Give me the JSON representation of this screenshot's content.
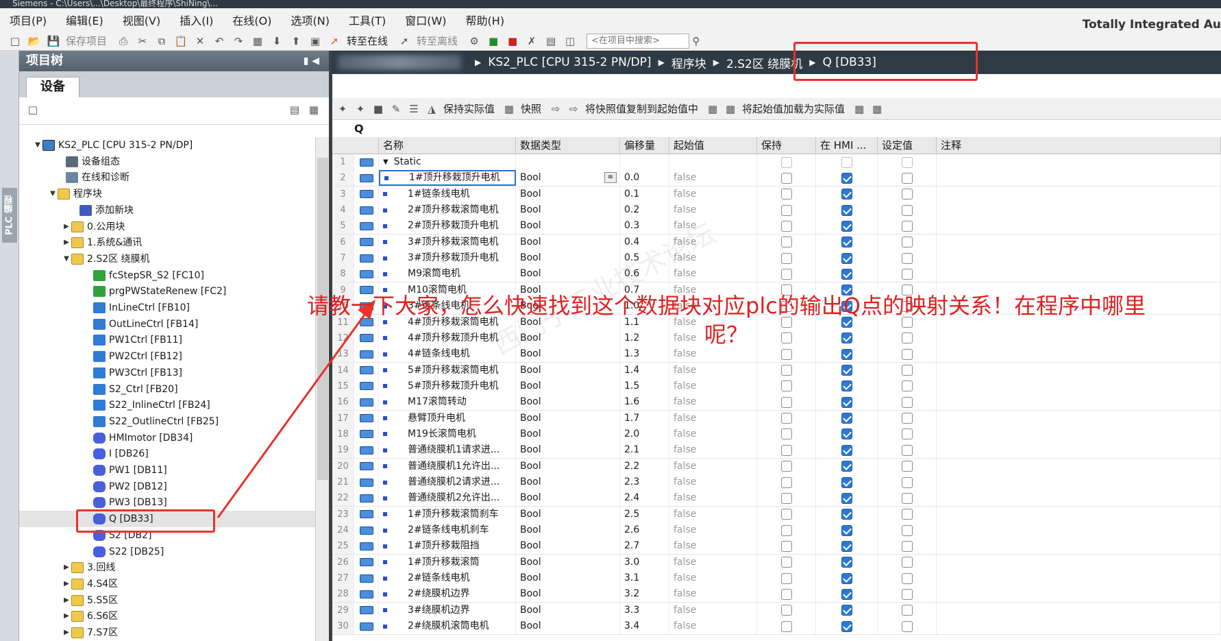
{
  "window": {
    "title": "Siemens - C:\\Users\\...\\Desktop\\最终程序\\ShiNing\\...",
    "brand": "Totally Integrated Au"
  },
  "menu": [
    "项目(P)",
    "编辑(E)",
    "视图(V)",
    "插入(I)",
    "在线(O)",
    "选项(N)",
    "工具(T)",
    "窗口(W)",
    "帮助(H)"
  ],
  "toolbar": {
    "save_project": "保存项目",
    "go_online": "转至在线",
    "go_offline": "转至离线",
    "search_placeholder": "<在项目中搜索>"
  },
  "sidetab": {
    "label": "PLC 编程"
  },
  "project_tree": {
    "header": "项目树",
    "devices_tab": "设备",
    "items": [
      {
        "label": "KS2_PLC [CPU 315-2 PN/DP]",
        "icon": "plc-icon"
      },
      {
        "label": "设备组态",
        "icon": "device-config-icon"
      },
      {
        "label": "在线和诊断",
        "icon": "diagnostics-icon"
      },
      {
        "label": "程序块",
        "icon": "folder-icon"
      },
      {
        "label": "添加新块",
        "icon": "add-block-icon"
      },
      {
        "label": "0.公用块",
        "icon": "folder-icon"
      },
      {
        "label": "1.系统&通讯",
        "icon": "folder-icon"
      },
      {
        "label": "2.S2区 绕膜机",
        "icon": "folder-icon"
      },
      {
        "label": "fcStepSR_S2 [FC10]",
        "icon": "fc-icon"
      },
      {
        "label": "prgPWStateRenew [FC2]",
        "icon": "fc-icon"
      },
      {
        "label": "InLineCtrl [FB10]",
        "icon": "fb-icon"
      },
      {
        "label": "OutLineCtrl [FB14]",
        "icon": "fb-icon"
      },
      {
        "label": "PW1Ctrl [FB11]",
        "icon": "fb-icon"
      },
      {
        "label": "PW2Ctrl [FB12]",
        "icon": "fb-icon"
      },
      {
        "label": "PW3Ctrl [FB13]",
        "icon": "fb-icon"
      },
      {
        "label": "S2_Ctrl [FB20]",
        "icon": "fb-icon"
      },
      {
        "label": "S22_InlineCtrl [FB24]",
        "icon": "fb-icon"
      },
      {
        "label": "S22_OutlineCtrl [FB25]",
        "icon": "fb-icon"
      },
      {
        "label": "HMImotor [DB34]",
        "icon": "db-icon"
      },
      {
        "label": "I [DB26]",
        "icon": "db-icon"
      },
      {
        "label": "PW1 [DB11]",
        "icon": "db-icon"
      },
      {
        "label": "PW2 [DB12]",
        "icon": "db-icon"
      },
      {
        "label": "PW3 [DB13]",
        "icon": "db-icon"
      },
      {
        "label": "Q [DB33]",
        "icon": "db-icon"
      },
      {
        "label": "S2 [DB2]",
        "icon": "db-icon"
      },
      {
        "label": "S22 [DB25]",
        "icon": "db-icon"
      },
      {
        "label": "3.回线",
        "icon": "folder-icon"
      },
      {
        "label": "4.S4区",
        "icon": "folder-icon"
      },
      {
        "label": "5.S5区",
        "icon": "folder-icon"
      },
      {
        "label": "6.S6区",
        "icon": "folder-icon"
      },
      {
        "label": "7.S7区",
        "icon": "folder-icon"
      }
    ]
  },
  "breadcrumb": [
    "KS2_PLC [CPU 315-2 PN/DP]",
    "程序块",
    "2.S2区 绕膜机",
    "Q [DB33]"
  ],
  "editor_toolbar": {
    "keep_actual": "保持实际值",
    "snapshot": "快照",
    "copy_snapshot": "将快照值复制到起始值中",
    "load_start": "将起始值加载为实际值"
  },
  "block_name": "Q",
  "columns": [
    "名称",
    "数据类型",
    "偏移量",
    "起始值",
    "保持",
    "在 HMI ...",
    "设定值",
    "注释"
  ],
  "rows": [
    {
      "n": "1",
      "name": "Static",
      "type": "",
      "offset": "",
      "start": ""
    },
    {
      "n": "2",
      "name": "1#顶升移栽顶升电机",
      "type": "Bool",
      "offset": "0.0",
      "start": "false"
    },
    {
      "n": "3",
      "name": "1#链条线电机",
      "type": "Bool",
      "offset": "0.1",
      "start": "false"
    },
    {
      "n": "4",
      "name": "2#顶升移栽滚筒电机",
      "type": "Bool",
      "offset": "0.2",
      "start": "false"
    },
    {
      "n": "5",
      "name": "2#顶升移栽顶升电机",
      "type": "Bool",
      "offset": "0.3",
      "start": "false"
    },
    {
      "n": "6",
      "name": "3#顶升移栽滚筒电机",
      "type": "Bool",
      "offset": "0.4",
      "start": "false"
    },
    {
      "n": "7",
      "name": "3#顶升移栽顶升电机",
      "type": "Bool",
      "offset": "0.5",
      "start": "false"
    },
    {
      "n": "8",
      "name": "M9滚筒电机",
      "type": "Bool",
      "offset": "0.6",
      "start": "false"
    },
    {
      "n": "9",
      "name": "M10滚筒电机",
      "type": "Bool",
      "offset": "0.7",
      "start": "false"
    },
    {
      "n": "10",
      "name": "3#链条线电机",
      "type": "Bool",
      "offset": "1.0",
      "start": "false"
    },
    {
      "n": "11",
      "name": "4#顶升移栽滚筒电机",
      "type": "Bool",
      "offset": "1.1",
      "start": "false"
    },
    {
      "n": "12",
      "name": "4#顶升移栽顶升电机",
      "type": "Bool",
      "offset": "1.2",
      "start": "false"
    },
    {
      "n": "13",
      "name": "4#链条线电机",
      "type": "Bool",
      "offset": "1.3",
      "start": "false"
    },
    {
      "n": "14",
      "name": "5#顶升移栽滚筒电机",
      "type": "Bool",
      "offset": "1.4",
      "start": "false"
    },
    {
      "n": "15",
      "name": "5#顶升移栽顶升电机",
      "type": "Bool",
      "offset": "1.5",
      "start": "false"
    },
    {
      "n": "16",
      "name": "M17滚筒转动",
      "type": "Bool",
      "offset": "1.6",
      "start": "false"
    },
    {
      "n": "17",
      "name": "悬臂顶升电机",
      "type": "Bool",
      "offset": "1.7",
      "start": "false"
    },
    {
      "n": "18",
      "name": "M19长滚筒电机",
      "type": "Bool",
      "offset": "2.0",
      "start": "false"
    },
    {
      "n": "19",
      "name": "普通绕膜机1请求进...",
      "type": "Bool",
      "offset": "2.1",
      "start": "false"
    },
    {
      "n": "20",
      "name": "普通绕膜机1允许出...",
      "type": "Bool",
      "offset": "2.2",
      "start": "false"
    },
    {
      "n": "21",
      "name": "普通绕膜机2请求进...",
      "type": "Bool",
      "offset": "2.3",
      "start": "false"
    },
    {
      "n": "22",
      "name": "普通绕膜机2允许出...",
      "type": "Bool",
      "offset": "2.4",
      "start": "false"
    },
    {
      "n": "23",
      "name": "1#顶升移栽滚筒刹车",
      "type": "Bool",
      "offset": "2.5",
      "start": "false"
    },
    {
      "n": "24",
      "name": "2#链条线电机刹车",
      "type": "Bool",
      "offset": "2.6",
      "start": "false"
    },
    {
      "n": "25",
      "name": "1#顶升移栽阻挡",
      "type": "Bool",
      "offset": "2.7",
      "start": "false"
    },
    {
      "n": "26",
      "name": "1#顶升移栽滚筒",
      "type": "Bool",
      "offset": "3.0",
      "start": "false"
    },
    {
      "n": "27",
      "name": "2#链条线电机",
      "type": "Bool",
      "offset": "3.1",
      "start": "false"
    },
    {
      "n": "28",
      "name": "2#绕膜机边界",
      "type": "Bool",
      "offset": "3.2",
      "start": "false"
    },
    {
      "n": "29",
      "name": "3#绕膜机边界",
      "type": "Bool",
      "offset": "3.3",
      "start": "false"
    },
    {
      "n": "30",
      "name": "2#绕膜机滚筒电机",
      "type": "Bool",
      "offset": "3.4",
      "start": "false"
    }
  ],
  "annotation": {
    "question": "请教一下大家，怎么快速找到这个数据块对应plc的输出Q点的映射关系！在程序中哪里呢？",
    "color": "#e02020"
  },
  "watermark": "西门子工业技术论坛"
}
